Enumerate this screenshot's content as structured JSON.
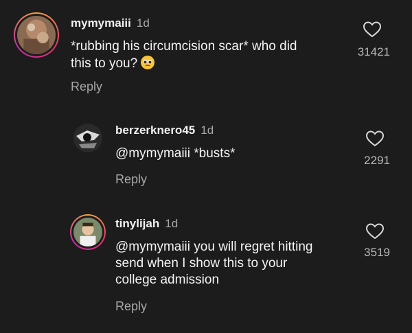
{
  "comments": [
    {
      "username": "mymymaiii",
      "time": "1d",
      "text_line1": "*rubbing his circumcision scar* who did",
      "text_line2": "this to you?",
      "emoji": "pleading-face",
      "reply_label": "Reply",
      "like_count": "31421"
    },
    {
      "username": "berzerknero45",
      "time": "1d",
      "mention": "@mymymaiii",
      "text": "*busts*",
      "reply_label": "Reply",
      "like_count": "2291"
    },
    {
      "username": "tinylijah",
      "time": "1d",
      "mention": "@mymymaiii",
      "text_line1": "you will regret hitting",
      "text_line2": "send when I show this to your",
      "text_line3": "college admission",
      "reply_label": "Reply",
      "like_count": "3519"
    }
  ],
  "colors": {
    "background": "#1c1c1c",
    "text": "#f2f2f2",
    "muted": "#a8a8a8",
    "story_ring": "#e8316d"
  },
  "icons": [
    "heart-outline-icon",
    "pleading-face-emoji"
  ]
}
